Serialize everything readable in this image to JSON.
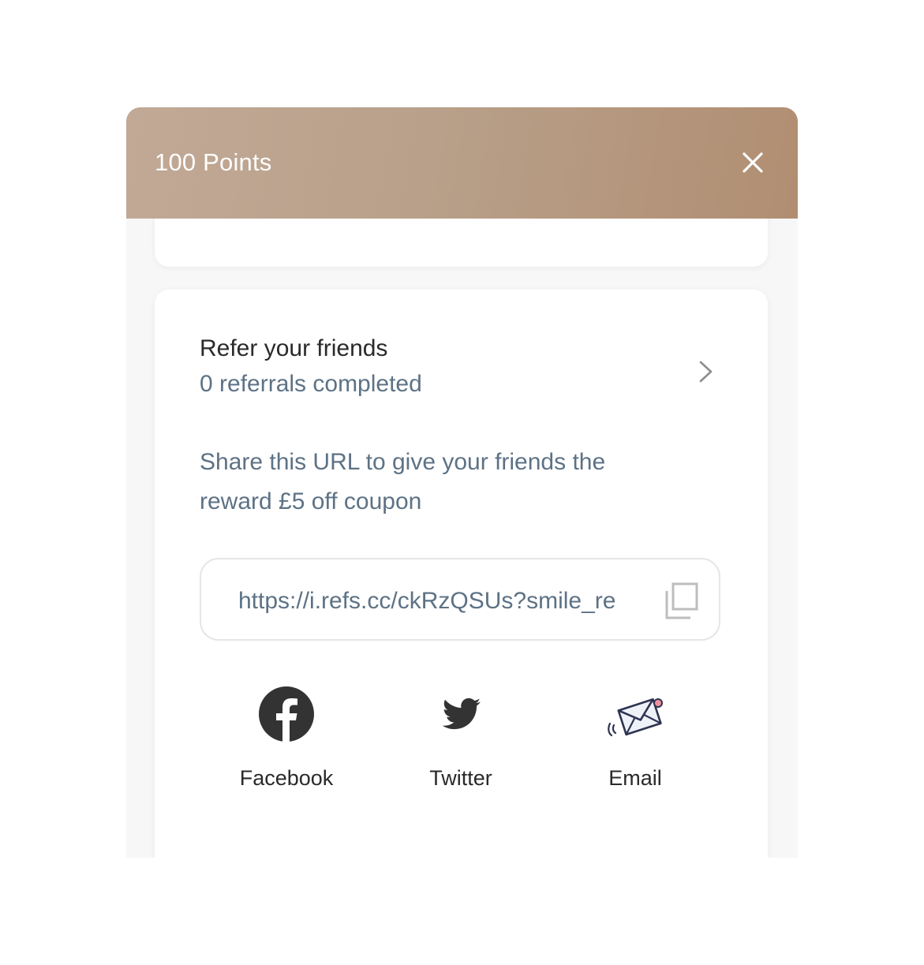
{
  "header": {
    "title": "100 Points",
    "close_icon": "close-icon"
  },
  "referral": {
    "title": "Refer your friends",
    "status": "0 referrals completed",
    "chevron_icon": "chevron-right-icon"
  },
  "share": {
    "description": "Share this URL to give your friends the reward £5 off coupon",
    "url": "https://i.refs.cc/ckRzQSUs?smile_re",
    "copy_icon": "copy-icon"
  },
  "share_options": [
    {
      "label": "Facebook",
      "icon": "facebook-icon"
    },
    {
      "label": "Twitter",
      "icon": "twitter-icon"
    },
    {
      "label": "Email",
      "icon": "email-envelope-icon"
    }
  ],
  "colors": {
    "header_gradient_start": "#c1a996",
    "header_gradient_end": "#b18e72",
    "text_primary": "#2a2a2a",
    "text_secondary": "#5d7285",
    "icon_dark": "#333333",
    "email_accent": "#f0919c"
  }
}
